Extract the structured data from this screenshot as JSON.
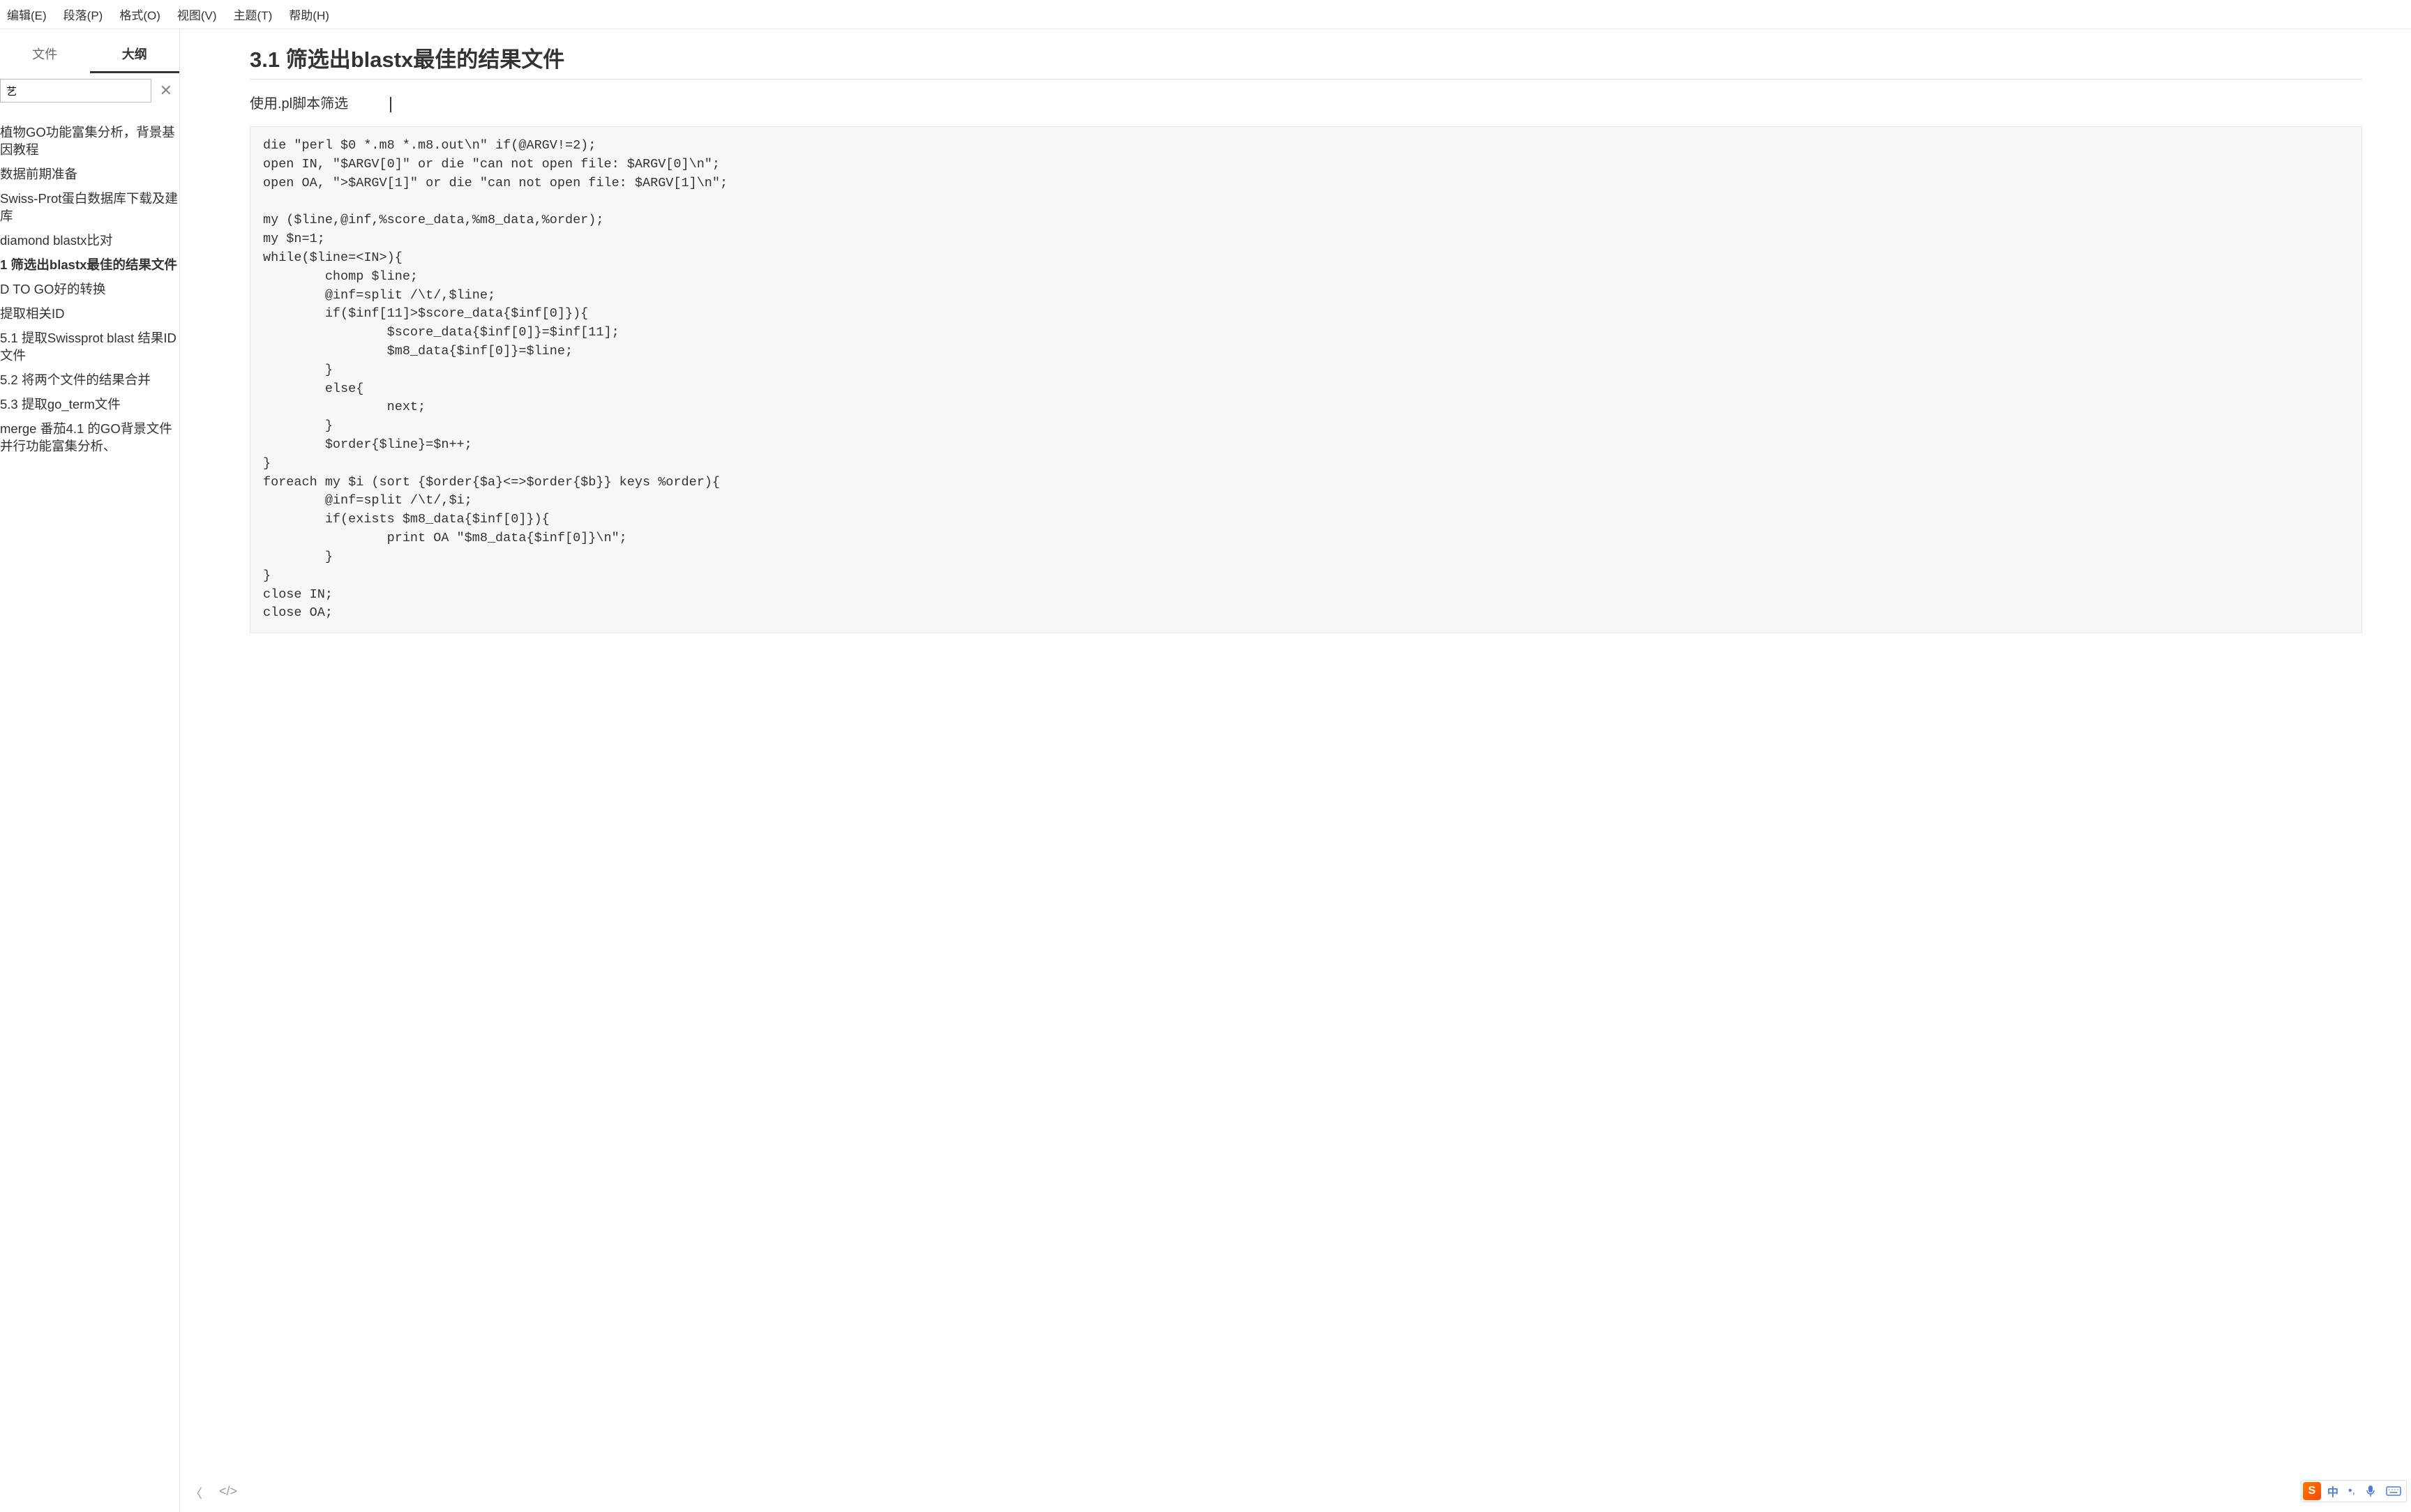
{
  "menubar": {
    "edit": "编辑(E)",
    "paragraph": "段落(P)",
    "format": "格式(O)",
    "view": "视图(V)",
    "theme": "主题(T)",
    "help": "帮助(H)"
  },
  "sidebar": {
    "tabs": {
      "file": "文件",
      "outline": "大纲"
    },
    "search_placeholder": "",
    "search_value": "艺",
    "items": [
      "植物GO功能富集分析，背景基因教程",
      "数据前期准备",
      "Swiss-Prot蛋白数据库下载及建库",
      "diamond blastx比对",
      "1 筛选出blastx最佳的结果文件",
      "D TO GO好的转换",
      "提取相关ID",
      "5.1 提取Swissprot blast 结果ID文件",
      "5.2 将两个文件的结果合并",
      "5.3 提取go_term文件",
      "merge 番茄4.1 的GO背景文件并行功能富集分析、"
    ],
    "active_index": 4
  },
  "content": {
    "heading": "3.1 筛选出blastx最佳的结果文件",
    "paragraph": "使用.pl脚本筛选",
    "code": "die \"perl $0 *.m8 *.m8.out\\n\" if(@ARGV!=2);\nopen IN, \"$ARGV[0]\" or die \"can not open file: $ARGV[0]\\n\";\nopen OA, \">$ARGV[1]\" or die \"can not open file: $ARGV[1]\\n\";\n\nmy ($line,@inf,%score_data,%m8_data,%order);\nmy $n=1;\nwhile($line=<IN>){\n        chomp $line;\n        @inf=split /\\t/,$line;\n        if($inf[11]>$score_data{$inf[0]}){\n                $score_data{$inf[0]}=$inf[11];\n                $m8_data{$inf[0]}=$line;\n        }\n        else{\n                next;\n        }\n        $order{$line}=$n++;\n}\nforeach my $i (sort {$order{$a}<=>$order{$b}} keys %order){\n        @inf=split /\\t/,$i;\n        if(exists $m8_data{$inf[0]}){\n                print OA \"$m8_data{$inf[0]}\\n\";\n        }\n}\nclose IN;\nclose OA;"
  },
  "bottombar": {
    "back": "〈",
    "code": "</>"
  },
  "ime": {
    "logo": "S",
    "lang": "中",
    "punct": "•,",
    "mic": "mic",
    "kbd": "kbd"
  }
}
